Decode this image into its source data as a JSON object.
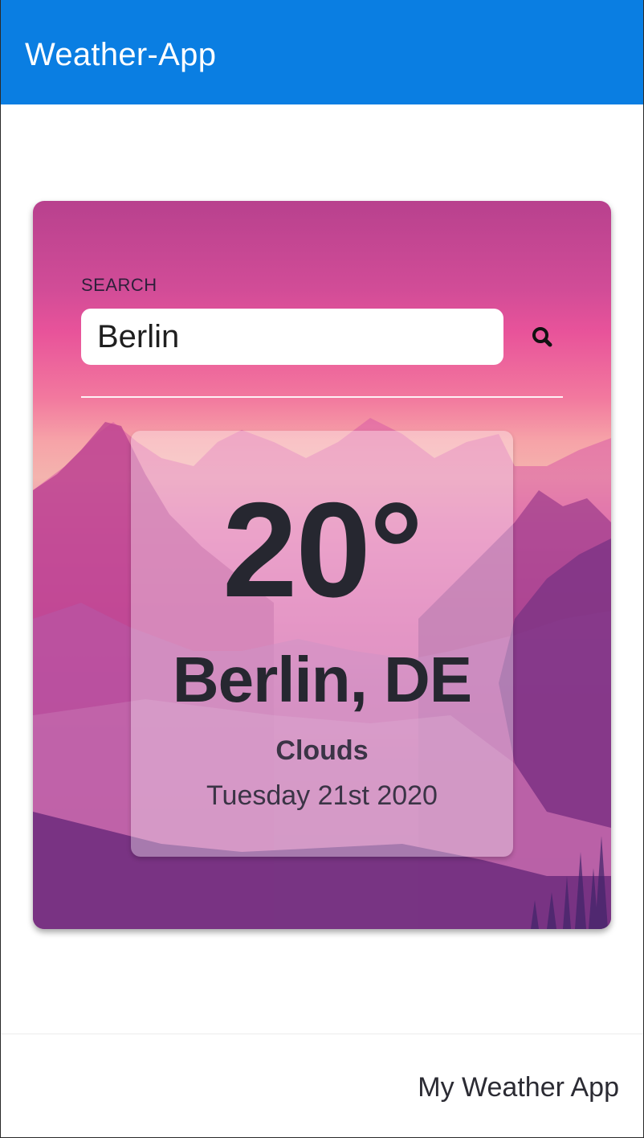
{
  "navbar": {
    "title": "Weather-App",
    "color": "#0a7ee2"
  },
  "search": {
    "label": "SEARCH",
    "value": "Berlin",
    "button_icon": "search-icon"
  },
  "weather": {
    "temperature": "20°",
    "location": "Berlin, DE",
    "condition": "Clouds",
    "date": "Tuesday 21st 2020"
  },
  "footer": {
    "text": "My Weather App"
  }
}
